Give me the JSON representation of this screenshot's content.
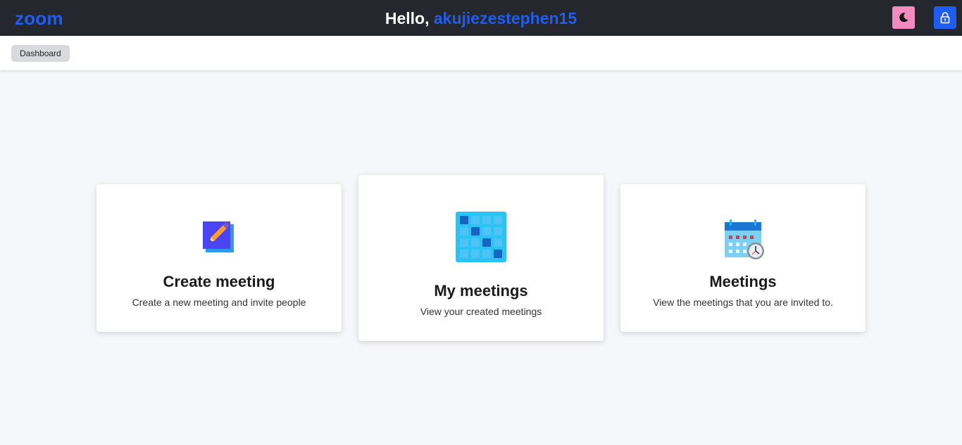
{
  "header": {
    "logo": "zoom",
    "greeting_prefix": "Hello,",
    "username": "akujiezestephen15",
    "theme_toggle_icon": "moon-icon",
    "logout_icon": "lock-icon"
  },
  "breadcrumb": {
    "items": [
      {
        "label": "Dashboard"
      }
    ]
  },
  "cards": [
    {
      "title": "Create meeting",
      "description": "Create a new meeting and invite people",
      "icon": "edit-square-icon"
    },
    {
      "title": "My meetings",
      "description": "View your created meetings",
      "icon": "calendar-grid-icon"
    },
    {
      "title": "Meetings",
      "description": "View the meetings that you are invited to.",
      "icon": "calendar-clock-icon"
    }
  ],
  "colors": {
    "accent": "#1f5cf0",
    "topbar": "#25272e",
    "theme_button": "#f38bc0",
    "page_bg": "#f6f7fa"
  }
}
